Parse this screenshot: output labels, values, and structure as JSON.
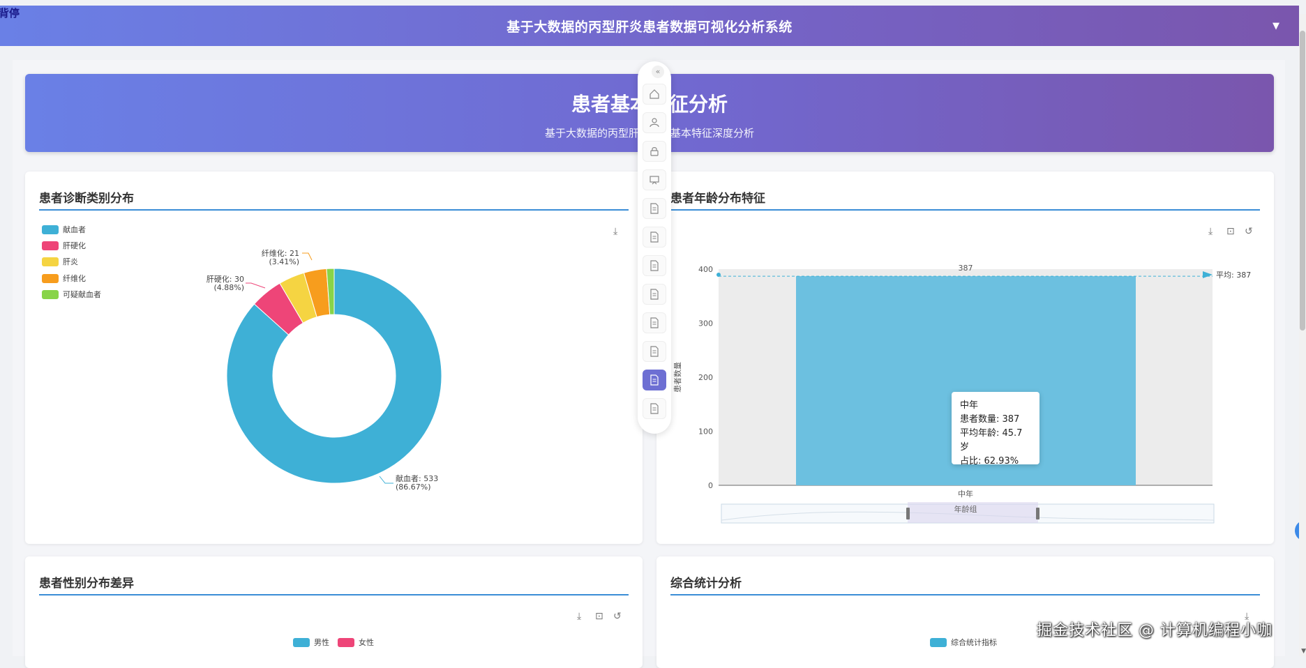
{
  "topbar": {
    "title": "基于大数据的丙型肝炎患者数据可视化分析系统",
    "corner_text": "背停"
  },
  "hero": {
    "title": "患者基本特征分析",
    "subtitle": "基于大数据的丙型肝炎患者基本特征深度分析"
  },
  "cards": {
    "diagnosis": {
      "title": "患者诊断类别分布"
    },
    "age": {
      "title": "患者年龄分布特征"
    },
    "gender": {
      "title": "患者性别分布差异"
    },
    "overall": {
      "title": "综合统计分析"
    }
  },
  "nav": {
    "collapse_glyph": "«",
    "active_index": 10,
    "items": [
      "home-icon",
      "user-icon",
      "lock-icon",
      "presentation-icon",
      "document-icon",
      "document-icon",
      "document-icon",
      "document-icon",
      "document-icon",
      "document-icon",
      "document-icon",
      "document-icon"
    ]
  },
  "tooltip": {
    "title": "中年",
    "count": "患者数量: 387",
    "avg_age": "平均年龄: 45.7岁",
    "ratio": "占比: 62.93%"
  },
  "watermark": "掘金技术社区 @ 计算机编程小咖",
  "colors": {
    "blue": "#3eb0d6",
    "pink": "#ee4578",
    "yellow": "#f5d442",
    "orange": "#f79d1d",
    "green": "#88d448"
  },
  "chart_data": [
    {
      "type": "pie",
      "title": "",
      "legend_position": "top-left",
      "categories": [
        "献血者",
        "肝硬化",
        "肝炎",
        "纤维化",
        "可疑献血者"
      ],
      "values": [
        533,
        30,
        24,
        21,
        7
      ],
      "labels": [
        {
          "text": "献血者: 533",
          "pct": "(86.67%)"
        },
        {
          "text": "肝硬化: 30",
          "pct": "(4.88%)"
        },
        {
          "text": "纤维化: 21",
          "pct": "(3.41%)"
        }
      ]
    },
    {
      "type": "bar",
      "categories": [
        "中年"
      ],
      "values": [
        387
      ],
      "xlabel": "年龄组",
      "ylabel": "患者数量",
      "ylim": [
        0,
        400
      ],
      "yticks": [
        0,
        100,
        200,
        300,
        400
      ],
      "data_label": "387",
      "mark_line": {
        "label": "平均: 387",
        "value": 387
      }
    },
    {
      "type": "bar",
      "legend": [
        "男性",
        "女性"
      ]
    },
    {
      "type": "bar",
      "legend": [
        "综合统计指标"
      ]
    }
  ]
}
